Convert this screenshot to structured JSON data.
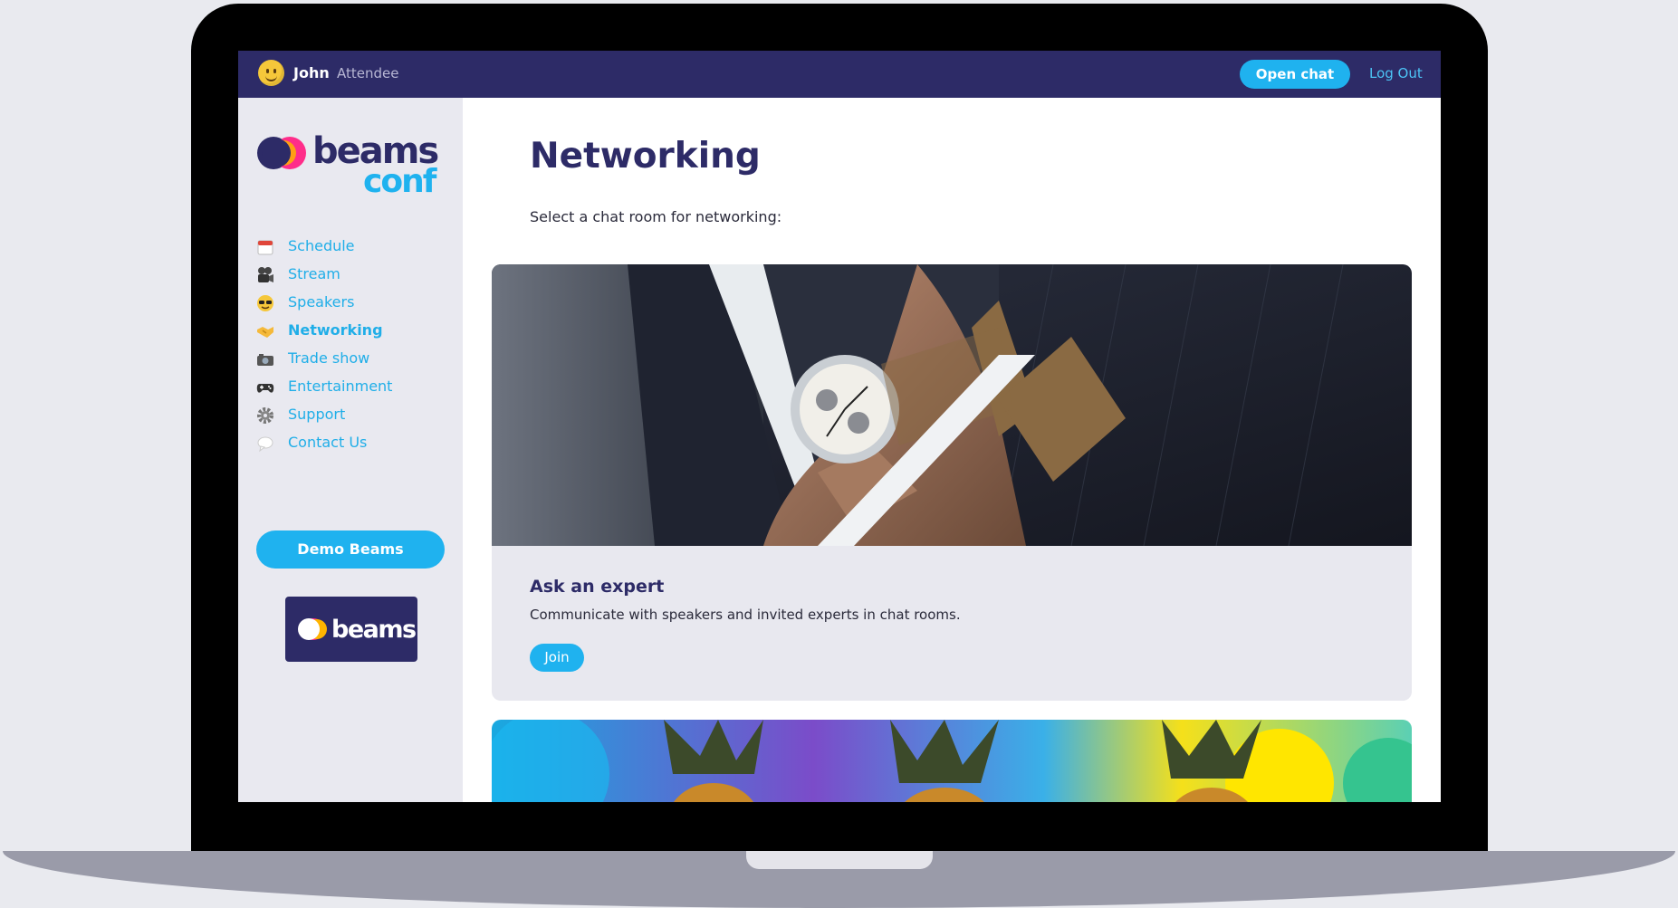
{
  "topbar": {
    "user_name": "John",
    "user_role": "Attendee",
    "open_chat_label": "Open chat",
    "logout_label": "Log Out"
  },
  "sidebar": {
    "items": [
      {
        "label": "Schedule",
        "icon": "calendar-icon"
      },
      {
        "label": "Stream",
        "icon": "movie-camera-icon"
      },
      {
        "label": "Speakers",
        "icon": "sunglasses-face-icon"
      },
      {
        "label": "Networking",
        "icon": "handshake-icon",
        "active": true
      },
      {
        "label": "Trade show",
        "icon": "camera-icon"
      },
      {
        "label": "Entertainment",
        "icon": "gamepad-icon"
      },
      {
        "label": "Support",
        "icon": "gear-icon"
      },
      {
        "label": "Contact Us",
        "icon": "speech-bubble-icon"
      }
    ],
    "demo_button_label": "Demo Beams"
  },
  "main": {
    "title": "Networking",
    "intro": "Select a chat room for networking:",
    "rooms": [
      {
        "title": "Ask an expert",
        "description": "Communicate with speakers and invited experts in chat rooms.",
        "join_label": "Join"
      }
    ]
  },
  "colors": {
    "navy": "#2d2b67",
    "accent": "#1fb2ef",
    "sidebar_bg": "#e9e9f0"
  }
}
